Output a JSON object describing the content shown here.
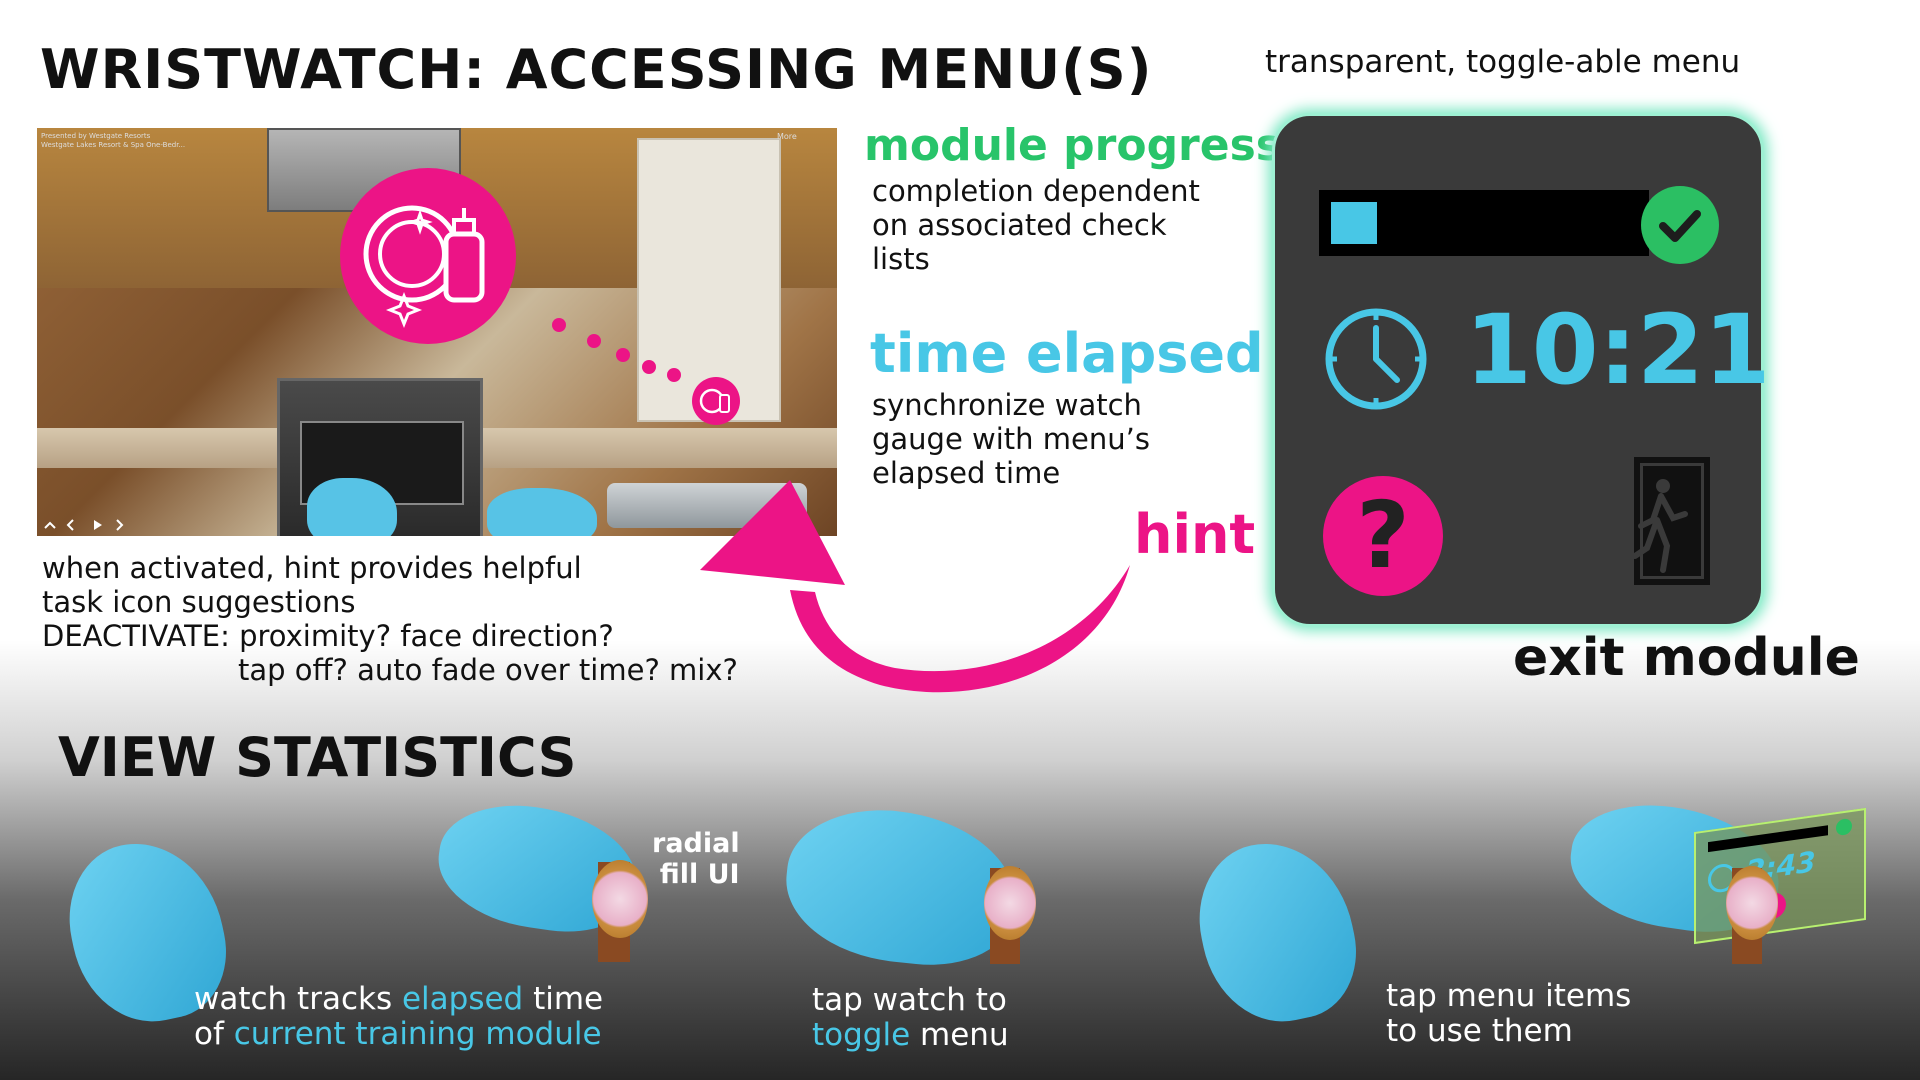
{
  "title": "WRISTWATCH: ACCESSING MENU(S)",
  "subtitle": "transparent, toggle-able menu",
  "scene": {
    "header_line1": "Presented by Westgate Resorts",
    "header_line2": "Westgate Lakes Resort & Spa One-Bedr...",
    "more_label": "More"
  },
  "annotations": {
    "module_progress": {
      "heading": "module progress",
      "lines": [
        "completion dependent",
        "on associated check",
        "lists"
      ]
    },
    "time_elapsed": {
      "heading": "time elapsed",
      "lines": [
        "synchronize watch",
        "gauge with menu’s",
        "elapsed time"
      ]
    },
    "hint": {
      "heading": "hint"
    },
    "exit": {
      "label": "exit module"
    }
  },
  "watch_menu": {
    "progress_fraction": 0.15,
    "time": "10:21",
    "help_glyph": "?",
    "icons": [
      "check-icon",
      "clock-icon",
      "help-icon",
      "exit-icon"
    ]
  },
  "hint_description": {
    "lines": [
      "when activated, hint provides helpful",
      "task icon suggestions",
      "DEACTIVATE: proximity? face direction?",
      "tap off? auto fade over time? mix?"
    ]
  },
  "stats": {
    "heading": "VIEW STATISTICS",
    "radial_label_1": "radial",
    "radial_label_2": "fill UI",
    "captions": [
      {
        "l1_a": "watch tracks ",
        "l1_hl": "elapsed",
        "l1_b": " time",
        "l2_a": "of ",
        "l2_hl": "current training module",
        "l2_b": ""
      },
      {
        "l1_a": "tap watch to",
        "l1_hl": "",
        "l1_b": "",
        "l2_a": "",
        "l2_hl": "toggle",
        "l2_b": " menu"
      },
      {
        "l1_a": "tap menu items",
        "l1_hl": "",
        "l1_b": "",
        "l2_a": "to use them",
        "l2_hl": "",
        "l2_b": ""
      }
    ],
    "mini_time": "2:43"
  },
  "colors": {
    "pink": "#ec1486",
    "cyan": "#48c7e6",
    "green": "#28c46a",
    "watch_bg": "#3a3a3a"
  }
}
